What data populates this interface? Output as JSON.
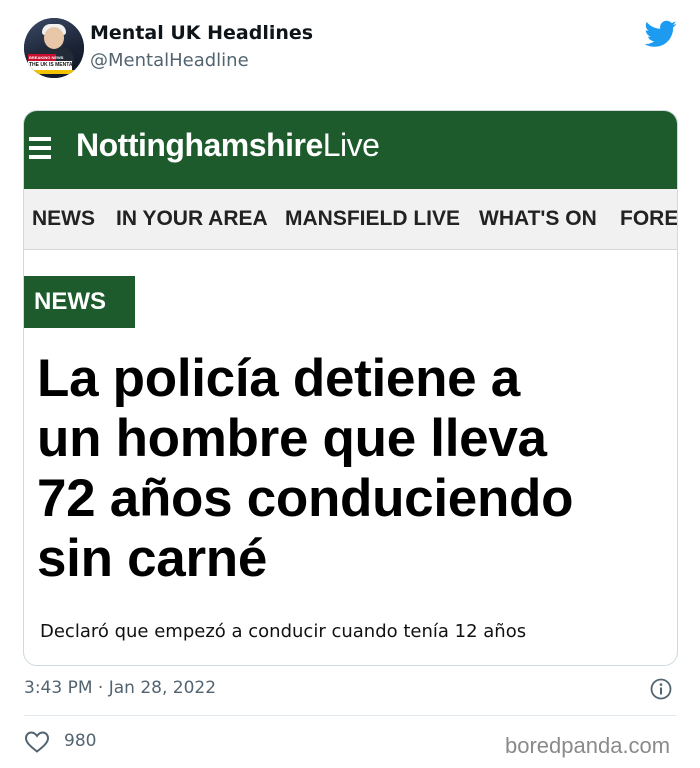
{
  "tweet": {
    "author_name": "Mental UK Headlines",
    "author_handle": "@MentalHeadline",
    "avatar_banner_top": "BREAKING NEWS",
    "avatar_banner_main": "THE UK IS MENTAL",
    "timestamp": "3:43 PM · Jan 28, 2022",
    "like_count": "980"
  },
  "article": {
    "brand_bold": "Nottinghamshire",
    "brand_light": "Live",
    "nav_items": [
      "NEWS",
      "IN YOUR AREA",
      "MANSFIELD LIVE",
      "WHAT'S ON",
      "FORES"
    ],
    "section_tag": "NEWS",
    "headline_lines": [
      "La policía detiene a",
      "un hombre que lleva",
      "72 años conduciendo",
      "sin carné"
    ],
    "subheadline": "Declaró que empezó a conducir cuando tenía 12 años"
  },
  "watermark": "boredpanda.com",
  "colors": {
    "brand_green": "#1e5b2c",
    "twitter_blue": "#1d9bf0",
    "muted_text": "#536471"
  },
  "icons": [
    "twitter-bird-icon",
    "hamburger-menu-icon",
    "info-icon",
    "heart-icon"
  ]
}
